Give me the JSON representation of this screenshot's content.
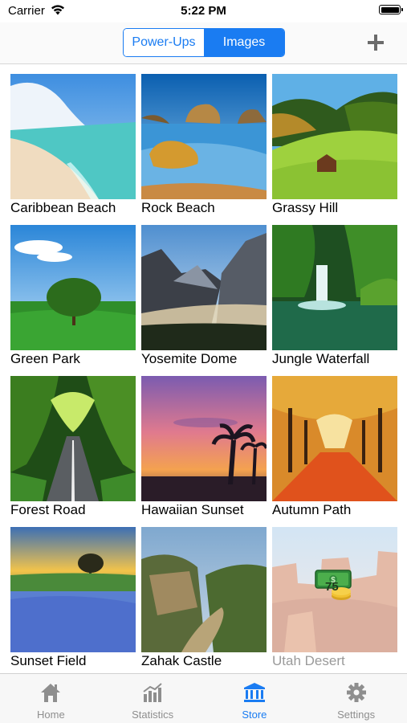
{
  "status_bar": {
    "carrier": "Carrier",
    "time": "5:22 PM"
  },
  "nav": {
    "segments": [
      "Power-Ups",
      "Images"
    ],
    "selected_segment": "Images",
    "add_icon": "plus-icon"
  },
  "images": [
    {
      "name": "Caribbean Beach",
      "locked": false
    },
    {
      "name": "Rock Beach",
      "locked": false
    },
    {
      "name": "Grassy Hill",
      "locked": false
    },
    {
      "name": "Green Park",
      "locked": false
    },
    {
      "name": "Yosemite Dome",
      "locked": false
    },
    {
      "name": "Jungle Waterfall",
      "locked": false
    },
    {
      "name": "Forest Road",
      "locked": false
    },
    {
      "name": "Hawaiian Sunset",
      "locked": false
    },
    {
      "name": "Autumn Path",
      "locked": false
    },
    {
      "name": "Sunset Field",
      "locked": false
    },
    {
      "name": "Zahak Castle",
      "locked": false
    },
    {
      "name": "Utah Desert",
      "locked": true,
      "price": "75",
      "price_icon": "money-stack-icon"
    }
  ],
  "tab_bar": {
    "tabs": [
      {
        "label": "Home",
        "icon": "home-icon"
      },
      {
        "label": "Statistics",
        "icon": "statistics-icon"
      },
      {
        "label": "Store",
        "icon": "store-icon"
      },
      {
        "label": "Settings",
        "icon": "gear-icon"
      }
    ],
    "active_tab": "Store"
  },
  "colors": {
    "accent": "#1a7cf2",
    "inactive": "#8e8e8e",
    "locked_text": "#9a9a9a"
  }
}
